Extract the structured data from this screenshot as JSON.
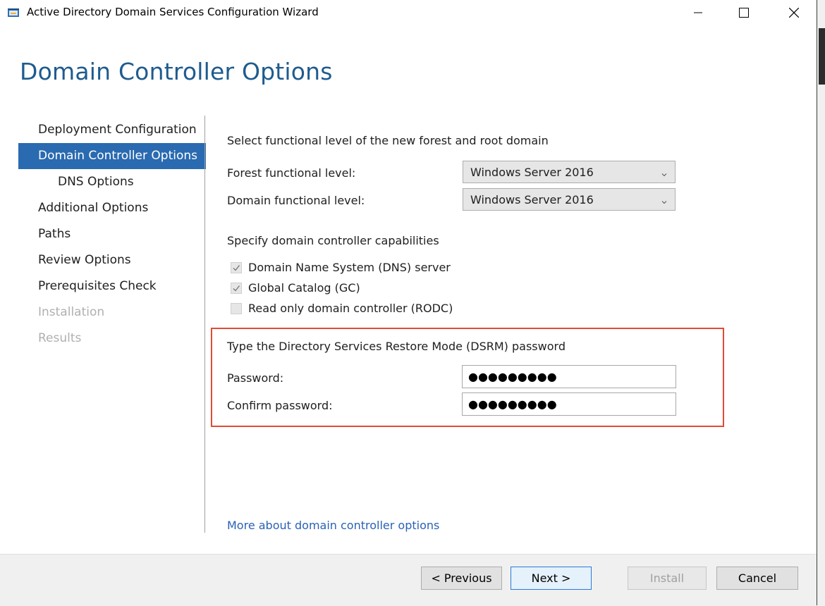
{
  "window": {
    "title": "Active Directory Domain Services Configuration Wizard",
    "controls": [
      "minimize",
      "maximize",
      "close"
    ]
  },
  "header": {
    "page_title": "Domain Controller Options"
  },
  "nav": {
    "items": [
      {
        "label": "Deployment Configuration",
        "state": "normal"
      },
      {
        "label": "Domain Controller Options",
        "state": "active"
      },
      {
        "label": "DNS Options",
        "state": "sub"
      },
      {
        "label": "Additional Options",
        "state": "normal"
      },
      {
        "label": "Paths",
        "state": "normal"
      },
      {
        "label": "Review Options",
        "state": "normal"
      },
      {
        "label": "Prerequisites Check",
        "state": "normal"
      },
      {
        "label": "Installation",
        "state": "disabled"
      },
      {
        "label": "Results",
        "state": "disabled"
      }
    ]
  },
  "functional_level": {
    "heading": "Select functional level of the new forest and root domain",
    "forest_label": "Forest functional level:",
    "forest_value": "Windows Server 2016",
    "domain_label": "Domain functional level:",
    "domain_value": "Windows Server 2016"
  },
  "capabilities": {
    "heading": "Specify domain controller capabilities",
    "options": [
      {
        "label": "Domain Name System (DNS) server",
        "checked": true
      },
      {
        "label": "Global Catalog (GC)",
        "checked": true
      },
      {
        "label": "Read only domain controller (RODC)",
        "checked": false
      }
    ]
  },
  "dsrm": {
    "heading": "Type the Directory Services Restore Mode (DSRM) password",
    "password_label": "Password:",
    "password_value": "●●●●●●●●●",
    "confirm_label": "Confirm password:",
    "confirm_value": "●●●●●●●●●"
  },
  "more_link": "More about domain controller options",
  "buttons": {
    "previous": "< Previous",
    "next": "Next >",
    "install": "Install",
    "cancel": "Cancel"
  },
  "colors": {
    "title_blue": "#1e5b8f",
    "nav_active": "#2a6ab0",
    "highlight_red": "#e04b35",
    "link_blue": "#2a62b5"
  }
}
